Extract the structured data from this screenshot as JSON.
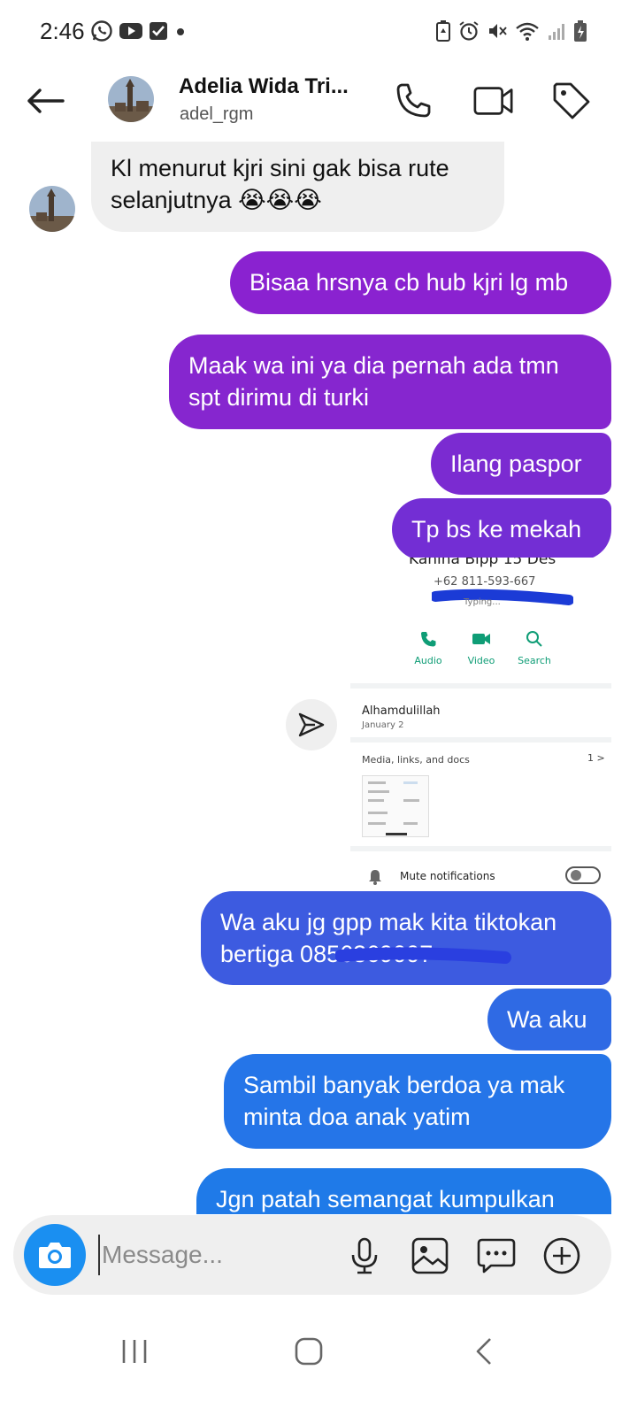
{
  "status_bar": {
    "time": "2:46"
  },
  "header": {
    "name": "Adelia Wida Tri...",
    "handle": "adel_rgm"
  },
  "messages": [
    {
      "direction": "incoming",
      "text_line1": "Kl menurut kjri sini gak bisa rute",
      "text_line2": "selanjutnya 😭😭😭"
    },
    {
      "direction": "outgoing",
      "text": "Bisaa hrsnya cb hub kjri lg mb"
    },
    {
      "direction": "outgoing",
      "text_line1": "Maak wa ini ya dia pernah ada tmn",
      "text_line2": "spt dirimu di turki"
    },
    {
      "direction": "outgoing",
      "text": "Ilang paspor"
    },
    {
      "direction": "outgoing",
      "text": "Tp bs ke mekah"
    },
    {
      "direction": "outgoing",
      "text_line1": "Wa aku jg gpp mak kita tiktokan",
      "text_line2": "bertiga 0856369007"
    },
    {
      "direction": "outgoing",
      "text": "Wa aku"
    },
    {
      "direction": "outgoing",
      "text_line1": "Sambil banyak berdoa ya mak",
      "text_line2": "minta doa anak yatim"
    },
    {
      "direction": "outgoing",
      "text": "Jgn patah semangat kumpulkan"
    }
  ],
  "shared_screenshot": {
    "contact_name": "Kahina Bipp 15 Des",
    "phone": "+62 811-593-667",
    "typing": "Typing...",
    "actions": [
      "Audio",
      "Video",
      "Search"
    ],
    "about_text": "Alhamdulillah",
    "about_date": "January 2",
    "media_label": "Media, links, and docs",
    "media_count": "1 >",
    "mute_label": "Mute notifications"
  },
  "composer": {
    "placeholder": "Message..."
  },
  "colors": {
    "bubble_purple": "#8a22d0",
    "bubble_violet": "#6a2fd8",
    "bubble_blue": "#3d5be0",
    "bubble_azure": "#1f7ae8",
    "incoming": "#efefef",
    "camera": "#1a8ff1"
  }
}
